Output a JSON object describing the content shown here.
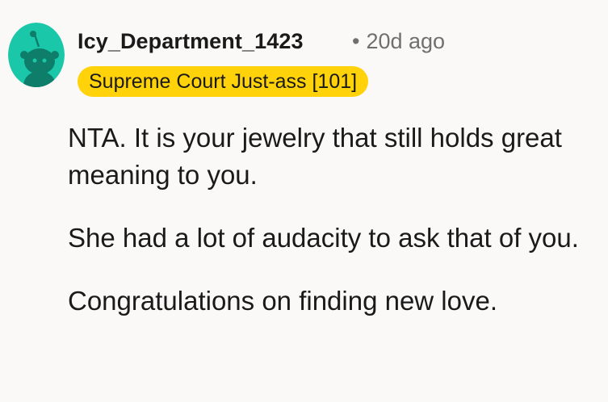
{
  "comment": {
    "avatar_icon": "snoo-avatar-icon",
    "avatar_color": "#1ac7a9",
    "username": "Icy_Department_1423",
    "separator": "•",
    "time": "20d ago",
    "flair": "Supreme Court Just-ass [101]",
    "flair_color": "#ffd20a",
    "paragraphs": [
      "NTA. It is your jewelry that still holds great meaning to you.",
      "She had a lot of audacity to ask that of you.",
      "Congratulations on finding new love."
    ]
  }
}
